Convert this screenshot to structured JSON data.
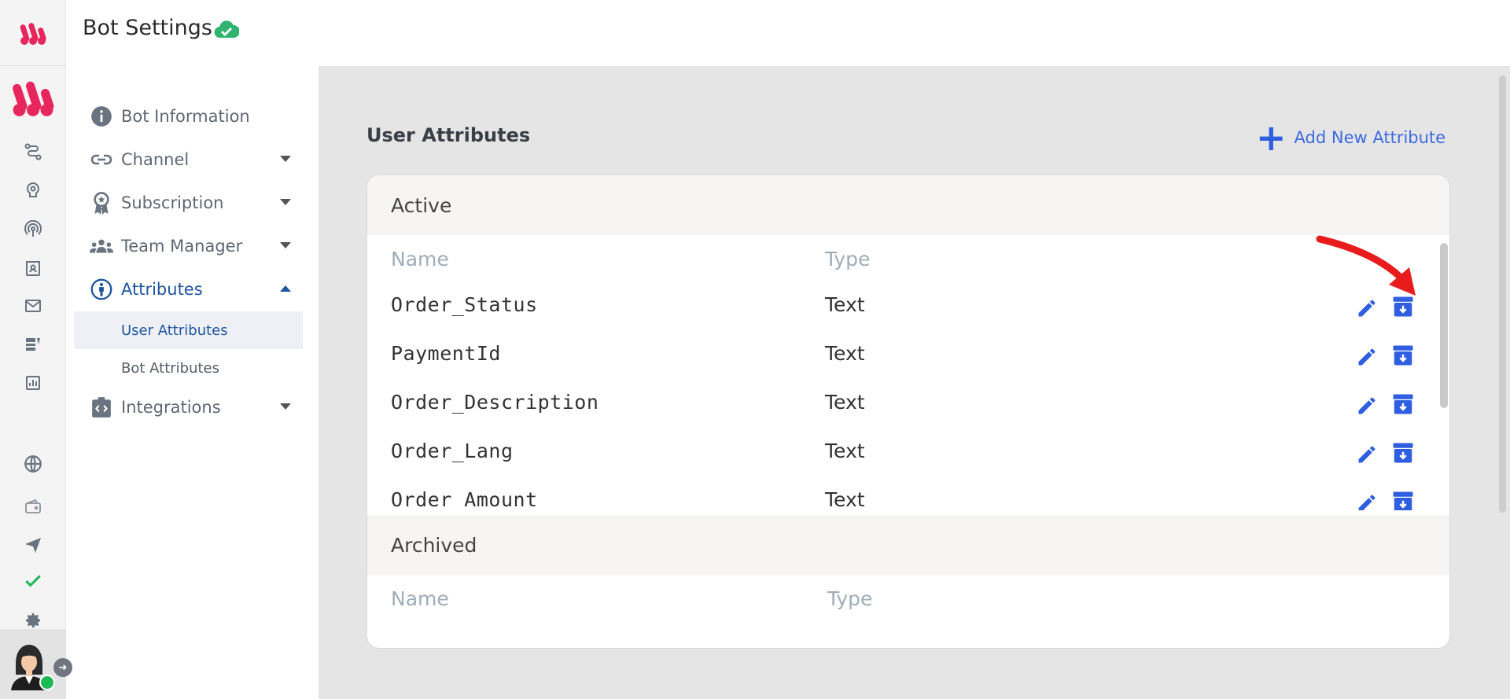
{
  "header": {
    "title": "Bot Settings"
  },
  "nav": {
    "items": [
      {
        "label": "Bot Information"
      },
      {
        "label": "Channel"
      },
      {
        "label": "Subscription"
      },
      {
        "label": "Team Manager"
      },
      {
        "label": "Attributes"
      },
      {
        "label": "Integrations"
      }
    ],
    "sub_items": [
      {
        "label": "User Attributes"
      },
      {
        "label": "Bot Attributes"
      }
    ]
  },
  "main": {
    "title": "User Attributes",
    "add_label": "Add New Attribute",
    "active": {
      "label": "Active",
      "col_name": "Name",
      "col_type": "Type",
      "rows": [
        {
          "name": "Order_Status",
          "type": "Text"
        },
        {
          "name": "PaymentId",
          "type": "Text"
        },
        {
          "name": "Order_Description",
          "type": "Text"
        },
        {
          "name": "Order_Lang",
          "type": "Text"
        },
        {
          "name": "Order_Amount",
          "type": "Text"
        }
      ]
    },
    "archived": {
      "label": "Archived",
      "col_name": "Name",
      "col_type": "Type"
    }
  },
  "colors": {
    "brand": "#e8265e",
    "accent": "#2f5fe0",
    "active_nav": "#1f55a0",
    "success": "#2fb36e"
  },
  "icons": {
    "rail": [
      "flow-icon",
      "brain-icon",
      "broadcast-icon",
      "contacts-icon",
      "mail-icon",
      "templates-icon",
      "analytics-icon",
      "globe-icon",
      "wallet-icon",
      "send-icon",
      "check-icon",
      "gear-icon"
    ]
  }
}
